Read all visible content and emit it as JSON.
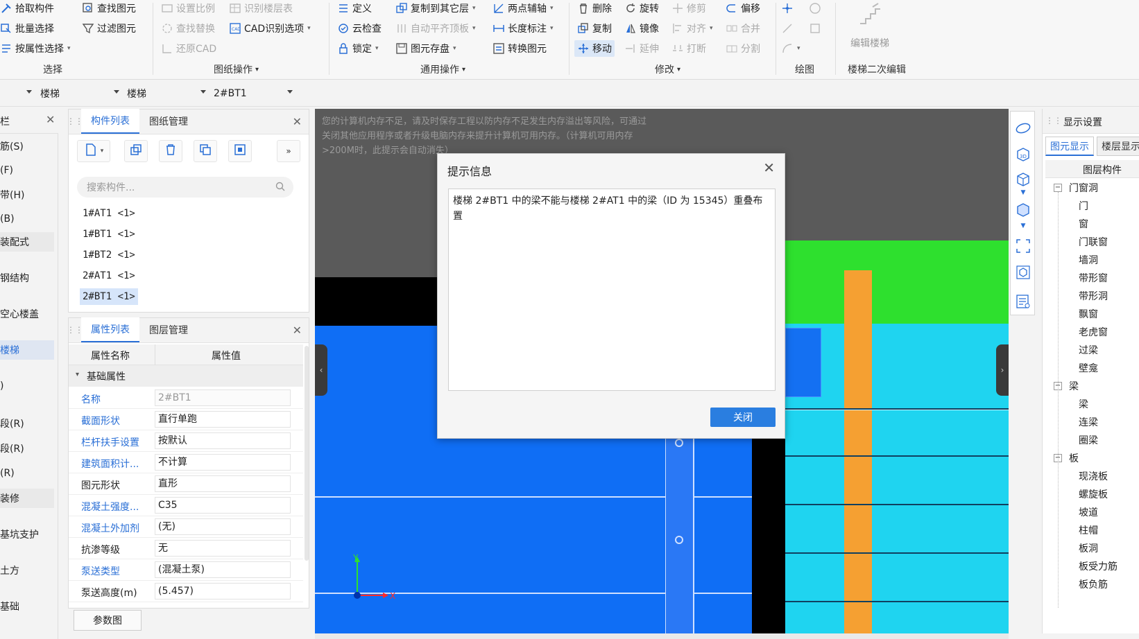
{
  "ribbon": {
    "select": {
      "pick": "拾取构件",
      "batch": "批量选择",
      "byattr": "按属性选择",
      "find": "查找图元",
      "filter": "过滤图元",
      "group": "选择"
    },
    "drawing": {
      "ratio": "设置比例",
      "floor": "识别楼层表",
      "findreplace": "查找替换",
      "cadopt": "CAD识别选项",
      "restore": "还原CAD",
      "group": "图纸操作"
    },
    "common": {
      "define": "定义",
      "copyto": "复制到其它层",
      "twopoint": "两点辅轴",
      "cloud": "云检查",
      "autoflat": "自动平齐顶板",
      "length": "长度标注",
      "lock": "锁定",
      "store": "图元存盘",
      "convert": "转换图元",
      "group": "通用操作"
    },
    "modify": {
      "delete": "删除",
      "rotate": "旋转",
      "trim": "修剪",
      "offset": "偏移",
      "copy": "复制",
      "mirror": "镜像",
      "align": "对齐",
      "merge": "合并",
      "move": "移动",
      "extend": "延伸",
      "break": "打断",
      "split": "分割",
      "group": "修改"
    },
    "draw": {
      "group": "绘图"
    },
    "stair": {
      "edit": "编辑楼梯",
      "group": "楼梯二次编辑"
    }
  },
  "toolbar2": {
    "combo1": "楼梯",
    "combo2": "楼梯",
    "combo3": "2#BT1"
  },
  "leftnav": {
    "items": [
      "筋(S)",
      "(F)",
      "带(H)",
      "(B)",
      "装配式",
      "钢结构",
      "空心楼盖",
      "楼梯",
      ")",
      "段(R)",
      "段(R)",
      "(R)",
      "装修",
      "基坑支护",
      "土方",
      "基础"
    ]
  },
  "comp_panel": {
    "tabs": [
      "构件列表",
      "图纸管理"
    ],
    "search_placeholder": "搜索构件...",
    "items": [
      "1#AT1 <1>",
      "1#BT1 <1>",
      "1#BT2 <1>",
      "2#AT1 <1>",
      "2#BT1 <1>"
    ]
  },
  "prop_panel": {
    "tabs": [
      "属性列表",
      "图层管理"
    ],
    "header": {
      "name": "属性名称",
      "value": "属性值"
    },
    "section": "基础属性",
    "rows": [
      {
        "k": "名称",
        "v": "2#BT1"
      },
      {
        "k": "截面形状",
        "v": "直行单跑"
      },
      {
        "k": "栏杆扶手设置",
        "v": "按默认"
      },
      {
        "k": "建筑面积计...",
        "v": "不计算"
      },
      {
        "k": "图元形状",
        "v": "直形"
      },
      {
        "k": "混凝土强度...",
        "v": "C35"
      },
      {
        "k": "混凝土外加剂",
        "v": "(无)"
      },
      {
        "k": "抗渗等级",
        "v": "无"
      },
      {
        "k": "泵送类型",
        "v": "(混凝土泵)"
      },
      {
        "k": "泵送高度(m)",
        "v": "(5.457)"
      }
    ],
    "param_btn": "参数图"
  },
  "canvas": {
    "warning": "您的计算机内存不足，请及时保存工程以防内存不足发生内存溢出等风险，可通过关闭其他应用程序或者升级电脑内存来提升计算机可用内存。（计算机可用内存>200M时，此提示会自动消失）",
    "axis_x": "X",
    "axis_y": "Y"
  },
  "dialog": {
    "title": "提示信息",
    "message": "楼梯 2#BT1 中的梁不能与楼梯 2#AT1 中的梁（ID 为 15345）重叠布置",
    "close_btn": "关闭"
  },
  "right_panel": {
    "title": "显示设置",
    "tabs": [
      "图元显示",
      "楼层显示"
    ],
    "col": "图层构件",
    "tree": [
      {
        "label": "门窗洞",
        "group": true
      },
      {
        "label": "门"
      },
      {
        "label": "窗"
      },
      {
        "label": "门联窗"
      },
      {
        "label": "墙洞"
      },
      {
        "label": "带形窗"
      },
      {
        "label": "带形洞"
      },
      {
        "label": "飘窗"
      },
      {
        "label": "老虎窗"
      },
      {
        "label": "过梁"
      },
      {
        "label": "壁龛"
      },
      {
        "label": "梁",
        "group": true
      },
      {
        "label": "梁"
      },
      {
        "label": "连梁"
      },
      {
        "label": "圈梁"
      },
      {
        "label": "板",
        "group": true
      },
      {
        "label": "现浇板"
      },
      {
        "label": "螺旋板"
      },
      {
        "label": "坡道"
      },
      {
        "label": "柱帽"
      },
      {
        "label": "板洞"
      },
      {
        "label": "板受力筋"
      },
      {
        "label": "板负筋"
      }
    ]
  },
  "colors": {
    "accent": "#2a6fd6",
    "canvas_blue": "#0f6ef5",
    "cyan": "#1fd4f0",
    "green": "#2ee02e",
    "orange": "#f5a032"
  }
}
